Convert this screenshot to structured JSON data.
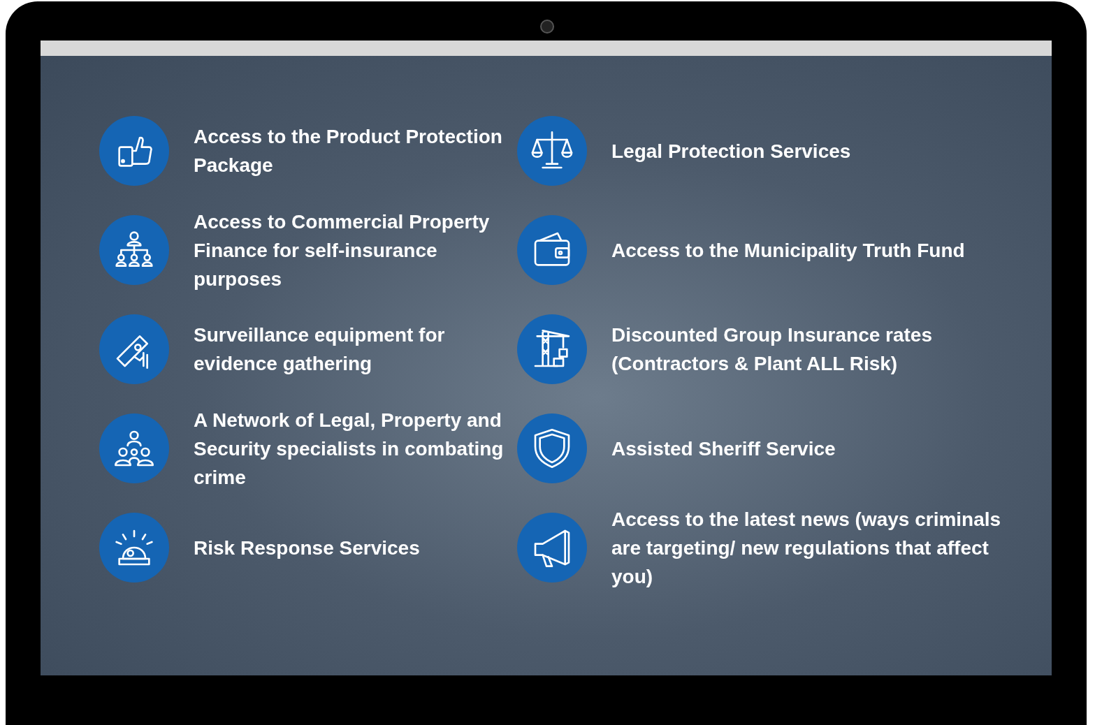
{
  "left_column": [
    {
      "kind": "thumbs-up",
      "text": "Access to the Product Protection Package"
    },
    {
      "kind": "org-chart",
      "text": "Access to Commercial Property Finance for self-insurance purposes"
    },
    {
      "kind": "camera",
      "text": "Surveillance equipment for evidence gathering"
    },
    {
      "kind": "network",
      "text": "A Network of Legal, Property and Security specialists in combating crime"
    },
    {
      "kind": "siren",
      "text": "Risk Response Services"
    }
  ],
  "right_column": [
    {
      "kind": "scales",
      "text": "Legal Protection Services"
    },
    {
      "kind": "wallet",
      "text": "Access to the Municipality Truth Fund"
    },
    {
      "kind": "crane",
      "text": "Discounted Group Insurance rates (Contractors & Plant ALL Risk)"
    },
    {
      "kind": "shield",
      "text": "Assisted Sheriff Service"
    },
    {
      "kind": "megaphone",
      "text": "Access to the latest news (ways criminals are targeting/ new regulations that affect you)"
    }
  ]
}
